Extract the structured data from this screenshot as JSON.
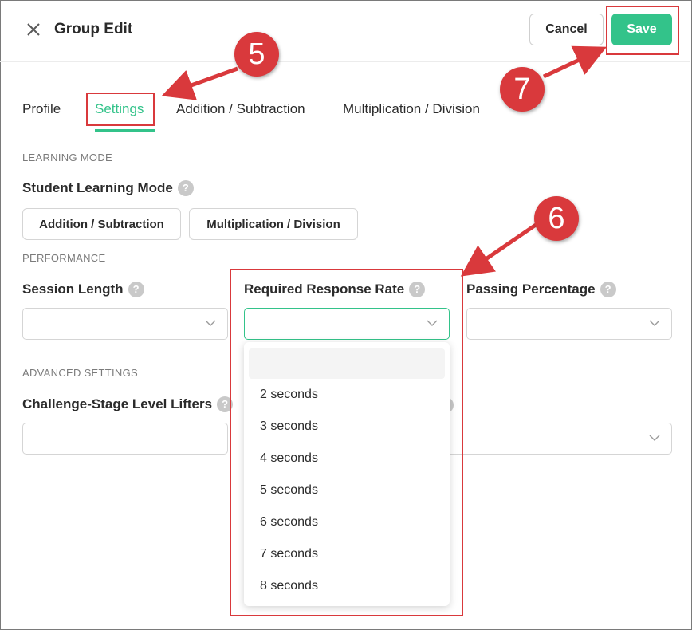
{
  "header": {
    "title": "Group Edit",
    "cancel_label": "Cancel",
    "save_label": "Save"
  },
  "tabs": [
    {
      "label": "Profile",
      "active": false
    },
    {
      "label": "Settings",
      "active": true
    },
    {
      "label": "Addition / Subtraction",
      "active": false
    },
    {
      "label": "Multiplication / Division",
      "active": false
    }
  ],
  "learning_mode": {
    "section_label": "LEARNING MODE",
    "field_label": "Student Learning Mode",
    "options": [
      "Addition / Subtraction",
      "Multiplication / Division"
    ]
  },
  "performance": {
    "section_label": "PERFORMANCE",
    "session_length_label": "Session Length",
    "response_rate_label": "Required Response Rate",
    "passing_percentage_label": "Passing Percentage"
  },
  "advanced": {
    "section_label": "ADVANCED SETTINGS",
    "level_lifters_label": "Challenge-Stage Level Lifters"
  },
  "dropdown": {
    "options": [
      "2 seconds",
      "3 seconds",
      "4 seconds",
      "5 seconds",
      "6 seconds",
      "7 seconds",
      "8 seconds"
    ]
  },
  "help_glyph": "?",
  "annotations": {
    "step_5": "5",
    "step_6": "6",
    "step_7": "7"
  },
  "colors": {
    "accent": "#33c38a",
    "annotation": "#d9393c"
  }
}
